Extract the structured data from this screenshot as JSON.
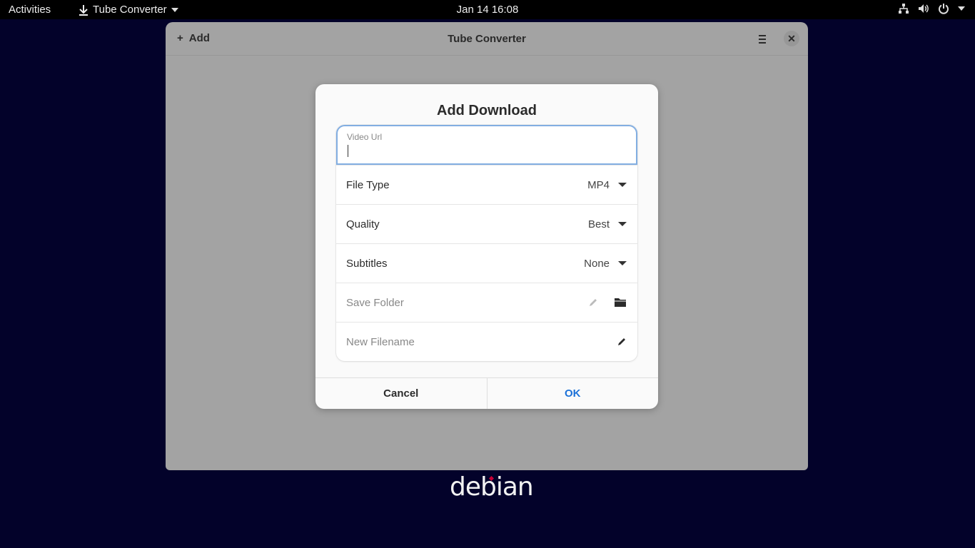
{
  "topbar": {
    "activities": "Activities",
    "app_name": "Tube Converter",
    "clock": "Jan 14  16:08"
  },
  "window": {
    "title": "Tube Converter",
    "add_label": "Add"
  },
  "dialog": {
    "title": "Add Download",
    "url_label": "Video Url",
    "url_value": "",
    "rows": [
      {
        "label": "File Type",
        "value": "MP4"
      },
      {
        "label": "Quality",
        "value": "Best"
      },
      {
        "label": "Subtitles",
        "value": "None"
      }
    ],
    "save_folder_label": "Save Folder",
    "new_filename_label": "New Filename",
    "cancel_label": "Cancel",
    "ok_label": "OK"
  },
  "desktop": {
    "logo_text": "debian"
  },
  "colors": {
    "accent": "#1c71d8",
    "focus_ring": "#82aee2",
    "desktop_bg": "#03022a"
  }
}
